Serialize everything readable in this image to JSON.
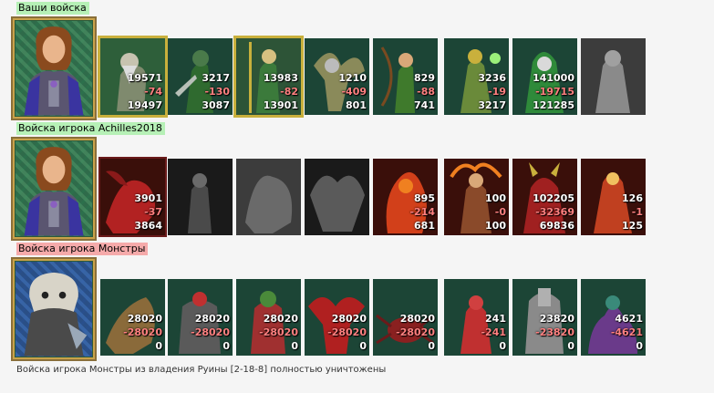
{
  "sections": [
    {
      "label": "Ваши войска",
      "units": [
        {
          "init": "19571",
          "loss": "-74",
          "rem": "19497"
        },
        {
          "init": "3217",
          "loss": "-130",
          "rem": "3087"
        },
        {
          "init": "13983",
          "loss": "-82",
          "rem": "13901"
        },
        {
          "init": "1210",
          "loss": "-409",
          "rem": "801"
        },
        {
          "init": "829",
          "loss": "-88",
          "rem": "741"
        },
        {
          "init": "3236",
          "loss": "-19",
          "rem": "3217"
        },
        {
          "init": "141000",
          "loss": "-19715",
          "rem": "121285"
        },
        {
          "init": "",
          "loss": "",
          "rem": ""
        }
      ]
    },
    {
      "label": "Войска игрока Achilles2018",
      "units": [
        {
          "init": "3901",
          "loss": "-37",
          "rem": "3864"
        },
        {
          "init": "",
          "loss": "",
          "rem": ""
        },
        {
          "init": "",
          "loss": "",
          "rem": ""
        },
        {
          "init": "",
          "loss": "",
          "rem": ""
        },
        {
          "init": "895",
          "loss": "-214",
          "rem": "681"
        },
        {
          "init": "100",
          "loss": "-0",
          "rem": "100"
        },
        {
          "init": "102205",
          "loss": "-32369",
          "rem": "69836"
        },
        {
          "init": "126",
          "loss": "-1",
          "rem": "125"
        }
      ]
    },
    {
      "label": "Войска игрока Монстры",
      "units": [
        {
          "init": "28020",
          "loss": "-28020",
          "rem": "0"
        },
        {
          "init": "28020",
          "loss": "-28020",
          "rem": "0"
        },
        {
          "init": "28020",
          "loss": "-28020",
          "rem": "0"
        },
        {
          "init": "28020",
          "loss": "-28020",
          "rem": "0"
        },
        {
          "init": "28020",
          "loss": "-28020",
          "rem": "0"
        },
        {
          "init": "241",
          "loss": "-241",
          "rem": "0"
        },
        {
          "init": "23820",
          "loss": "-23820",
          "rem": "0"
        },
        {
          "init": "4621",
          "loss": "-4621",
          "rem": "0"
        }
      ]
    }
  ],
  "footer": "Войска игрока Монстры из владения Руины [2-18-8] полностью уничтожены"
}
